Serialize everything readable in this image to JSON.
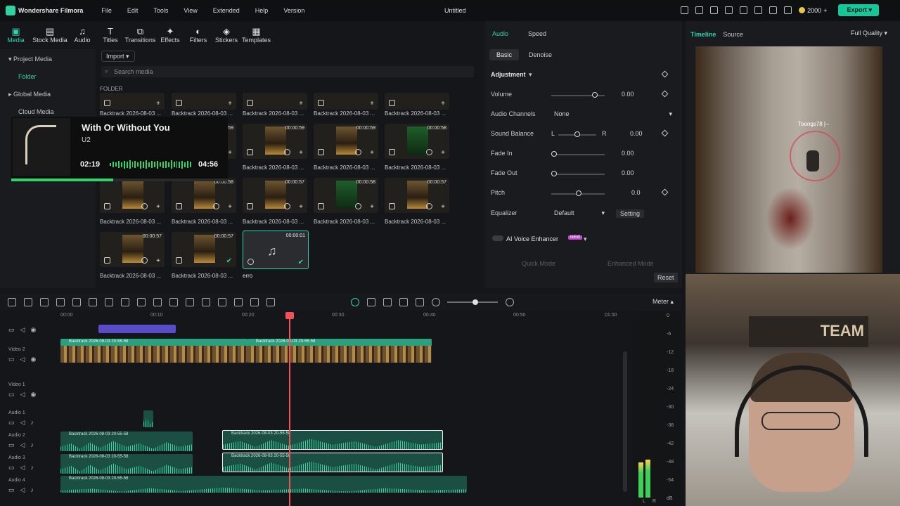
{
  "titlebar": {
    "app": "Wondershare Filmora",
    "menu": [
      "File",
      "Edit",
      "Tools",
      "View",
      "Extended",
      "Help",
      "Version"
    ],
    "doc": "Untitled",
    "credits": "2000",
    "export": "Export"
  },
  "toolbar": [
    "Media",
    "Stock Media",
    "Audio",
    "Titles",
    "Transitions",
    "Effects",
    "Filters",
    "Stickers",
    "Templates"
  ],
  "left": {
    "items": [
      "Project Media",
      "Folder",
      "Global Media",
      "Cloud Media"
    ]
  },
  "media": {
    "import": "Import",
    "search": "Search media",
    "folder": "FOLDER",
    "clipname": "Backtrack 2026-08-03 ...",
    "durations": [
      "00:00:59",
      "00:00:59",
      "00:00:59",
      "00:00:58",
      "00:00:57",
      "00:00:58",
      "00:00:57",
      "00:00:57"
    ],
    "music_clip": {
      "duration": "00:00:01",
      "name": "erro"
    }
  },
  "music": {
    "title": "With Or Without You",
    "artist": "U2",
    "elapsed": "02:19",
    "total": "04:56",
    "progress": 0.47
  },
  "props": {
    "tabs": [
      "Audio",
      "Speed"
    ],
    "subtabs": [
      "Basic",
      "Denoise"
    ],
    "section": "Adjustment",
    "volume_label": "Volume",
    "volume": "0.00",
    "channels_label": "Audio Channels",
    "channels": "None",
    "balance_label": "Sound Balance",
    "balance_l": "L",
    "balance_r": "R",
    "balance": "0.00",
    "fadein_label": "Fade In",
    "fadein": "0.00",
    "fadeout_label": "Fade Out",
    "fadeout": "0.00",
    "pitch_label": "Pitch",
    "pitch": "0.0",
    "eq_label": "Equalizer",
    "eq": "Default",
    "setting": "Setting",
    "ai": "AI Voice Enhancer",
    "ai_badge": "NEW",
    "quick": "Quick Mode",
    "enhanced": "Enhanced Mode",
    "reset": "Reset"
  },
  "preview": {
    "tabs": [
      "Timeline",
      "Source"
    ],
    "quality": "Full Quality",
    "player_tag": "Toongs78 |--"
  },
  "webcam": {
    "banner": "TEAM"
  },
  "timeline": {
    "meter": "Meter",
    "ruler": [
      "00:00",
      "00:10",
      "00:20",
      "00:30",
      "00:40",
      "00:50",
      "01:00"
    ],
    "tracks": [
      "Video 2",
      "Video 1",
      "Audio 1",
      "Audio 2",
      "Audio 3",
      "Audio 4"
    ],
    "clip": "Backtrack 2026-08-03 20-55-58",
    "meter_scale": [
      "0",
      "-6",
      "-12",
      "-18",
      "-24",
      "-30",
      "-36",
      "-42",
      "-48",
      "-54",
      "dB"
    ],
    "meter_lr": [
      "L",
      "R"
    ]
  }
}
